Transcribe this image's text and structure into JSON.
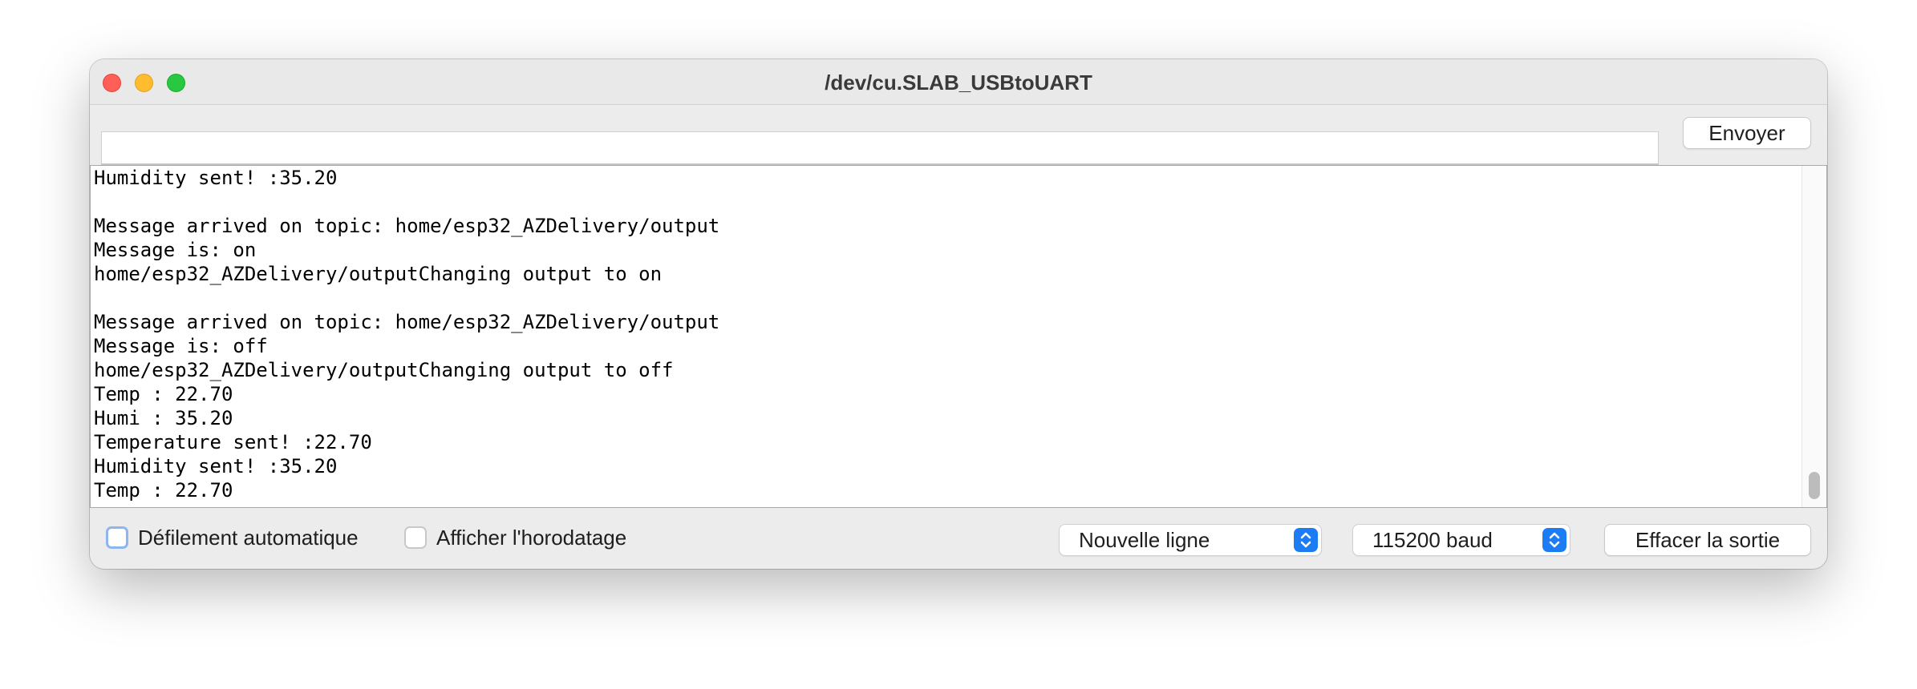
{
  "window": {
    "title": "/dev/cu.SLAB_USBtoUART"
  },
  "send": {
    "input_value": "",
    "button_label": "Envoyer"
  },
  "console": {
    "lines": [
      "Humidity sent! :35.20",
      "",
      "Message arrived on topic: home/esp32_AZDelivery/output",
      "Message is: on",
      "home/esp32_AZDelivery/outputChanging output to on",
      "",
      "Message arrived on topic: home/esp32_AZDelivery/output",
      "Message is: off",
      "home/esp32_AZDelivery/outputChanging output to off",
      "Temp : 22.70",
      "Humi : 35.20",
      "Temperature sent! :22.70",
      "Humidity sent! :35.20",
      "Temp : 22.70"
    ]
  },
  "footer": {
    "autoscroll_label": "Défilement automatique",
    "autoscroll_checked": false,
    "timestamp_label": "Afficher l'horodatage",
    "timestamp_checked": false,
    "line_ending": "Nouvelle ligne",
    "baud_rate": "115200 baud",
    "clear_label": "Effacer la sortie"
  },
  "colors": {
    "close": "#ff5f57",
    "minimize": "#febc2e",
    "zoom": "#28c840",
    "accent": "#1b7cf4"
  },
  "icons": {
    "window_close": "close-icon",
    "window_minimize": "minimize-icon",
    "window_zoom": "zoom-icon",
    "select_stepper": "chevron-up-down-icon"
  }
}
